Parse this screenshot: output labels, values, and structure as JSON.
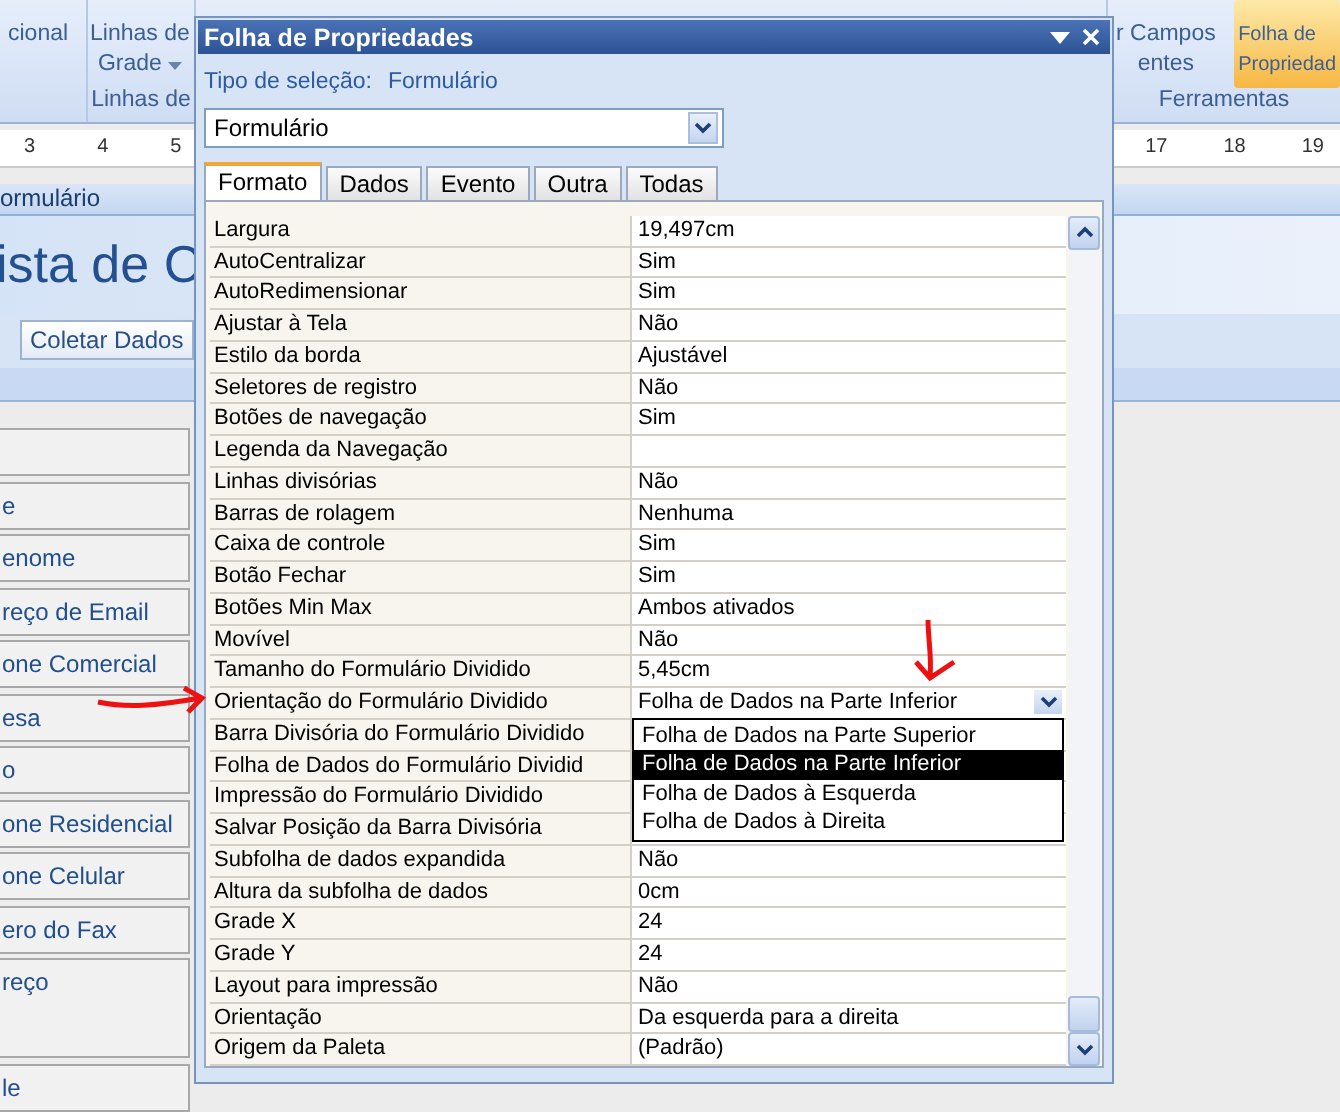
{
  "ribbon": {
    "left_cut_label": "cional",
    "gridlines_button": {
      "line1": "Linhas de",
      "line2": "Grade"
    },
    "left_group_label": "Linhas de",
    "fields_button": {
      "line1": "r Campos",
      "line2": "entes"
    },
    "property_sheet_button": {
      "line1": "Folha de",
      "line2": "Propriedad",
      "selected": true
    },
    "right_group_label": "Ferramentas"
  },
  "ruler": {
    "left_marks": [
      "3",
      "4",
      "5"
    ],
    "right_marks": [
      "17",
      "18",
      "19"
    ]
  },
  "form": {
    "tab_title": "ormulário",
    "header_title": "ista de C",
    "toolbar_button": "Coletar Dados",
    "fields": [
      {
        "kind": "text"
      },
      {
        "kind": "text",
        "label": "e"
      },
      {
        "kind": "text",
        "label": "enome"
      },
      {
        "kind": "text",
        "label": "reço de Email"
      },
      {
        "kind": "text",
        "label": "one Comercial"
      },
      {
        "kind": "text",
        "label": "esa"
      },
      {
        "kind": "text",
        "label": "o"
      },
      {
        "kind": "text",
        "label": "one Residencial"
      },
      {
        "kind": "text",
        "label": "one Celular"
      },
      {
        "kind": "text",
        "label": "ero do Fax"
      },
      {
        "kind": "memo",
        "label": "reço"
      },
      {
        "kind": "text",
        "label": "le"
      }
    ]
  },
  "property_sheet": {
    "title": "Folha de Propriedades",
    "selection_type_label": "Tipo de seleção:",
    "selection_type": "Formulário",
    "object_combo": {
      "value": "Formulário"
    },
    "tabs": [
      {
        "label": "Formato",
        "selected": true
      },
      {
        "label": "Dados",
        "selected": false
      },
      {
        "label": "Evento",
        "selected": false
      },
      {
        "label": "Outra",
        "selected": false
      },
      {
        "label": "Todas",
        "selected": false
      }
    ],
    "properties": [
      {
        "name": "Largura",
        "value": "19,497cm",
        "kind": "text"
      },
      {
        "name": "AutoCentralizar",
        "value": "Sim",
        "kind": "text"
      },
      {
        "name": "AutoRedimensionar",
        "value": "Sim",
        "kind": "text"
      },
      {
        "name": "Ajustar à Tela",
        "value": "Não",
        "kind": "text"
      },
      {
        "name": "Estilo da borda",
        "value": "Ajustável",
        "kind": "text"
      },
      {
        "name": "Seletores de registro",
        "value": "Não",
        "kind": "text"
      },
      {
        "name": "Botões de navegação",
        "value": "Sim",
        "kind": "text"
      },
      {
        "name": "Legenda da Navegação",
        "kind": "text"
      },
      {
        "name": "Linhas divisórias",
        "value": "Não",
        "kind": "text"
      },
      {
        "name": "Barras de rolagem",
        "value": "Nenhuma",
        "kind": "text"
      },
      {
        "name": "Caixa de controle",
        "value": "Sim",
        "kind": "text"
      },
      {
        "name": "Botão Fechar",
        "value": "Sim",
        "kind": "text"
      },
      {
        "name": "Botões Min Max",
        "value": "Ambos ativados",
        "kind": "text"
      },
      {
        "name": "Movível",
        "value": "Não",
        "kind": "text"
      },
      {
        "name": "Tamanho do Formulário Dividido",
        "value": "5,45cm",
        "kind": "text"
      },
      {
        "name": "Orientação do Formulário Dividido",
        "value": "Folha de Dados na Parte Inferior",
        "kind": "dropdown",
        "options": [
          {
            "label": "Folha de Dados na Parte Superior",
            "selected": false
          },
          {
            "label": "Folha de Dados na Parte Inferior",
            "selected": true
          },
          {
            "label": "Folha de Dados à Esquerda",
            "selected": false
          },
          {
            "label": "Folha de Dados à Direita",
            "selected": false
          }
        ]
      },
      {
        "name": "Barra Divisória do Formulário Dividido",
        "kind": "text"
      },
      {
        "name": "Folha de Dados do Formulário Dividid",
        "kind": "text"
      },
      {
        "name": "Impressão do Formulário Dividido",
        "kind": "text"
      },
      {
        "name": "Salvar Posição da Barra Divisória",
        "kind": "text"
      },
      {
        "name": "Subfolha de dados expandida",
        "value": "Não",
        "kind": "text"
      },
      {
        "name": "Altura da subfolha de dados",
        "value": "0cm",
        "kind": "text"
      },
      {
        "name": "Grade X",
        "value": "24",
        "kind": "text"
      },
      {
        "name": "Grade Y",
        "value": "24",
        "kind": "text"
      },
      {
        "name": "Layout para impressão",
        "value": "Não",
        "kind": "text"
      },
      {
        "name": "Orientação",
        "value": "Da esquerda para a direita",
        "kind": "text"
      },
      {
        "name": "Origem da Paleta",
        "value": "(Padrão)",
        "kind": "text"
      }
    ]
  }
}
